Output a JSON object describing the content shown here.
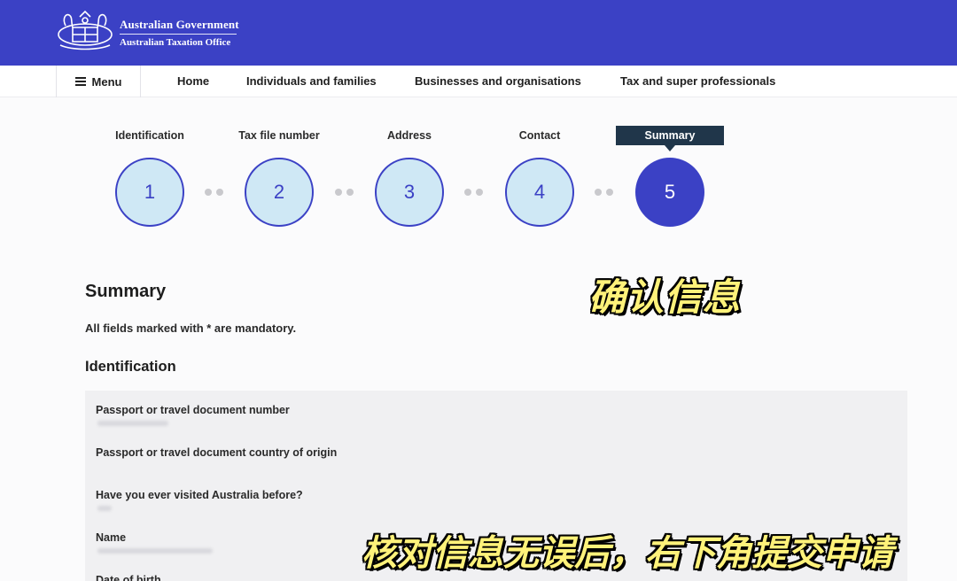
{
  "header": {
    "gov_name": "Australian Government",
    "agency_name": "Australian Taxation Office",
    "brand_color": "#3b41c5",
    "crest_icon": "coat-of-arms"
  },
  "nav": {
    "menu_label": "Menu",
    "menu_icon": "hamburger-icon",
    "links": [
      "Home",
      "Individuals and families",
      "Businesses and organisations",
      "Tax and super professionals"
    ]
  },
  "stepper": {
    "current_step": 5,
    "steps": [
      {
        "label": "Identification",
        "number": "1"
      },
      {
        "label": "Tax file number",
        "number": "2"
      },
      {
        "label": "Address",
        "number": "3"
      },
      {
        "label": "Contact",
        "number": "4"
      },
      {
        "label": "Summary",
        "number": "5"
      }
    ]
  },
  "main": {
    "title": "Summary",
    "mandatory_note": "All fields marked with * are mandatory.",
    "section_title": "Identification",
    "fields": [
      "Passport or travel document number",
      "Passport or travel document country of origin",
      "Have you ever visited Australia before?",
      "Name",
      "Date of birth"
    ]
  },
  "overlay": {
    "caption_top": "确认信息",
    "caption_bottom": "核对信息无误后，右下角提交申请",
    "caption_color": "#fff27a"
  }
}
